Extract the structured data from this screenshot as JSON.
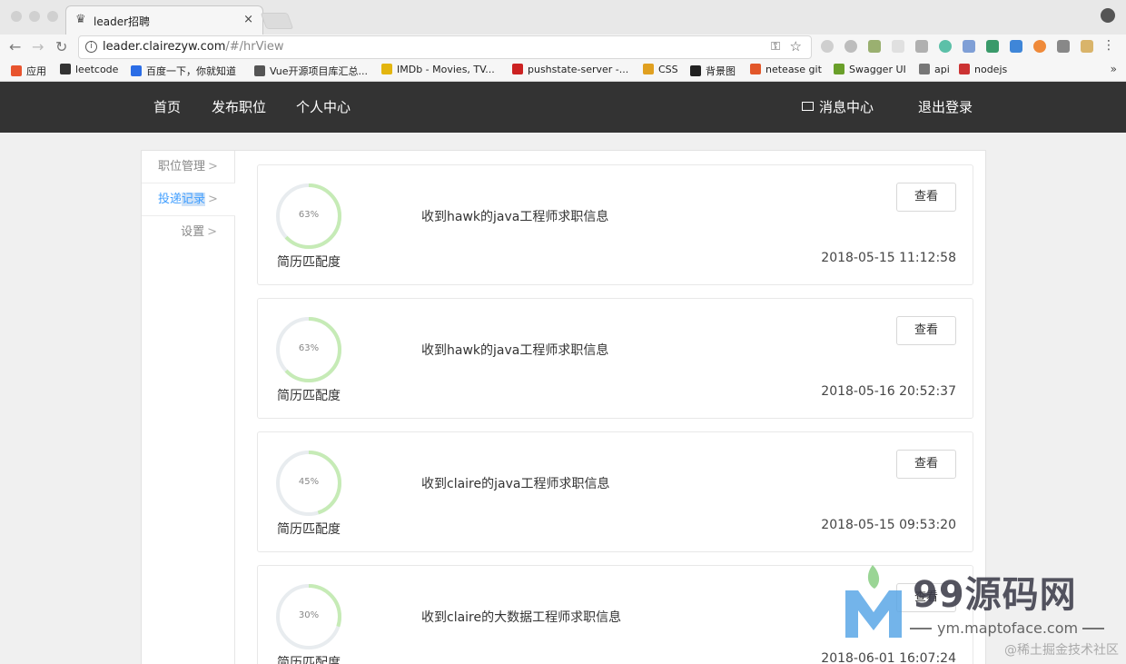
{
  "browser": {
    "tab_title": "leader招聘",
    "tab_close": "×",
    "url_host": "leader.clairezyw.com",
    "url_path": "/#/hrView"
  },
  "bookmarks": [
    {
      "label": "应用",
      "color": "#e8542e"
    },
    {
      "label": "leetcode",
      "color": "#333333"
    },
    {
      "label": "百度一下，你就知道",
      "color": "#2b6de6"
    },
    {
      "label": "Vue开源项目库汇总...",
      "color": "#555555"
    },
    {
      "label": "IMDb - Movies, TV...",
      "color": "#e3b50f"
    },
    {
      "label": "pushstate-server -...",
      "color": "#cc2222"
    },
    {
      "label": "CSS",
      "color": "#e0a020"
    },
    {
      "label": "背景图",
      "color": "#222222"
    },
    {
      "label": "netease git",
      "color": "#e2572a"
    },
    {
      "label": "Swagger UI",
      "color": "#6a9f2a"
    },
    {
      "label": "api",
      "color": "#777777"
    },
    {
      "label": "nodejs",
      "color": "#cc3333"
    }
  ],
  "nav": {
    "home": "首页",
    "post_job": "发布职位",
    "profile": "个人中心",
    "messages": "消息中心",
    "logout": "退出登录"
  },
  "sidebar": {
    "items": [
      {
        "label": "职位管理",
        "chevron": ">"
      },
      {
        "label_a": "投递",
        "label_b": "记录",
        "chevron": ">"
      },
      {
        "label": "设置",
        "chevron": ">"
      }
    ]
  },
  "applications": [
    {
      "percent": "63%",
      "match": 0.63,
      "label": "简历匹配度",
      "title": "收到hawk的java工程师求职信息",
      "button": "查看",
      "time": "2018-05-15 11:12:58"
    },
    {
      "percent": "63%",
      "match": 0.63,
      "label": "简历匹配度",
      "title": "收到hawk的java工程师求职信息",
      "button": "查看",
      "time": "2018-05-16 20:52:37"
    },
    {
      "percent": "45%",
      "match": 0.45,
      "label": "简历匹配度",
      "title": "收到claire的java工程师求职信息",
      "button": "查看",
      "time": "2018-05-15 09:53:20"
    },
    {
      "percent": "30%",
      "match": 0.3,
      "label": "简历匹配度",
      "title": "收到claire的大数据工程师求职信息",
      "button": "查看",
      "time": "2018-06-01 16:07:24"
    }
  ],
  "watermark": {
    "brand": "99源码网",
    "url": "ym.maptoface.com",
    "footer": "@稀土掘金技术社区"
  },
  "colors": {
    "nav_bg": "#333333",
    "ring_track": "#e8ecef",
    "ring_fill": "#c6ebb6",
    "active_link": "#409eff"
  }
}
